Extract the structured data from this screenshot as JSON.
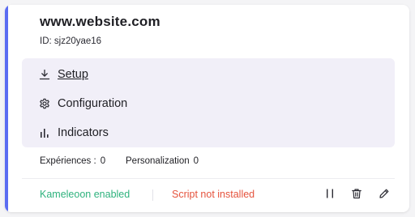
{
  "site": {
    "title": "www.website.com",
    "id_text": "ID: sjz20yae16"
  },
  "menu": {
    "items": [
      {
        "label": "Setup",
        "icon": "download-icon",
        "active": true
      },
      {
        "label": "Configuration",
        "icon": "gear-icon",
        "active": false
      },
      {
        "label": "Indicators",
        "icon": "bar-chart-icon",
        "active": false
      }
    ]
  },
  "counts": {
    "experiences_label": "Expériences :",
    "experiences_value": "0",
    "personalization_label": "Personalization",
    "personalization_value": "0"
  },
  "status": {
    "kameleoon": "Kameleoon enabled",
    "script": "Script not installed"
  },
  "actions": {
    "pause": "pause-icon",
    "delete": "trash-icon",
    "edit": "pencil-icon"
  },
  "colors": {
    "accent": "#5b6cf2",
    "success": "#2eb27d",
    "error": "#e5533d",
    "menu_bg": "#f1eff8"
  }
}
